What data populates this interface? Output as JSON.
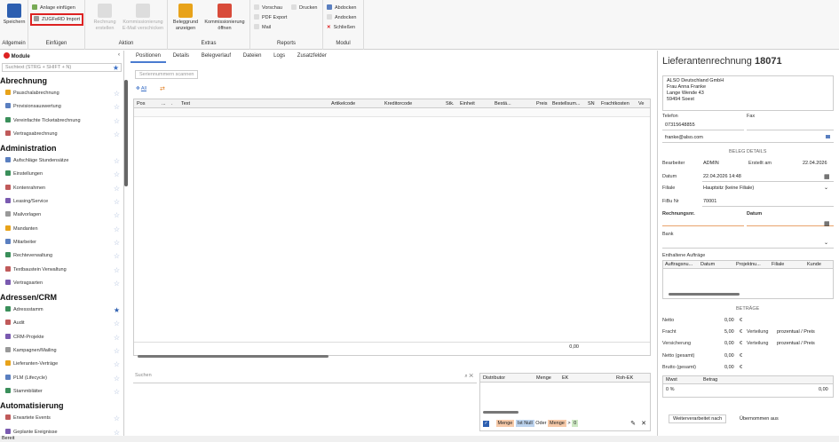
{
  "ribbon": {
    "allgemein": {
      "speichern": "Speichern",
      "label": "Allgemein"
    },
    "einfuegen": {
      "anlage": "Anlage einfügen",
      "zugferd": "ZUGFeRD Import",
      "label": "Einfügen"
    },
    "aktion": {
      "rechnung": "Rechnung erstellen",
      "kommission": "Kommissionierung E-Mail verschicken",
      "label": "Aktion"
    },
    "extras": {
      "beleggrund": "Beleggrund anzeigen",
      "kommissionierung": "Kommissionierung öffnen",
      "label": "Extras"
    },
    "reports": {
      "vorschau": "Vorschau",
      "drucken": "Drucken",
      "pdf": "PDF Export",
      "mail": "Mail",
      "label": "Reports"
    },
    "modul": {
      "abdocken": "Abdocken",
      "andocken": "Andocken",
      "schliessen": "Schließen",
      "label": "Modul"
    }
  },
  "sidebar": {
    "title": "Module",
    "collapse": "‹",
    "search_placeholder": "Suchtext (STRG + SHIFT + N)",
    "sections": [
      {
        "title": "Abrechnung",
        "items": [
          "Pauschalabrechnung",
          "Provisionsauswertung",
          "Vereinfachte Ticketabrechnung",
          "Vertragsabrechnung"
        ]
      },
      {
        "title": "Administration",
        "items": [
          "Aufschläge Stundensätze",
          "Einstellungen",
          "Kontenrahmen",
          "Leasing/Service",
          "Mailvorlagen",
          "Mandanten",
          "Mitarbeiter",
          "Rechteverwaltung",
          "Textbaustein Verwaltung",
          "Vertragsarten"
        ]
      },
      {
        "title": "Adressen/CRM",
        "items": [
          "Adressstamm",
          "Audit",
          "CRM-Projekte",
          "Kampagnen/Mailing",
          "Lieferanten-Verträge",
          "PLM (Lifecycle)",
          "Stammblätter"
        ]
      },
      {
        "title": "Automatisierung",
        "items": [
          "Erwartete Events",
          "Geplante Ereignisse"
        ]
      }
    ]
  },
  "tabs": [
    "Positionen",
    "Details",
    "Belegverlauf",
    "Dateien",
    "Logs",
    "Zusatzfelder"
  ],
  "toolbar": {
    "scan": "Seriennummern scannen",
    "all": "All"
  },
  "grid": {
    "columns": [
      "Pos",
      "...",
      ".",
      "Text",
      "Artikelcode",
      "Kreditorcode",
      "Stk.",
      "Einheit",
      "Bestä...",
      "Preis",
      "Bestellsum...",
      "SN",
      "Frachtkosten",
      "Ve"
    ],
    "total": "0,00"
  },
  "bottom": {
    "search_placeholder": "Suchen",
    "dist_cols": [
      "Distributor",
      "Menge",
      "EK",
      "Roh-EK"
    ],
    "filter": [
      "Menge",
      "Ist Null",
      "Oder",
      "Menge",
      ">",
      "0"
    ]
  },
  "right": {
    "title": "Lieferantenrechnung",
    "number": "18071",
    "address": [
      "ALSO Deutschland GmbH",
      "Frau Anna Franke",
      "Lange Wende 43",
      "59494 Soest"
    ],
    "telefon_lbl": "Telefon",
    "telefon": "07315648855",
    "fax_lbl": "Fax",
    "email": "franke@also.com",
    "details_title": "BELEG DETAILS",
    "bearbeiter_lbl": "Bearbeiter",
    "bearbeiter": "ADMIN",
    "erstellt_lbl": "Erstellt am",
    "erstellt": "22.04.2026",
    "datum_lbl": "Datum",
    "datum": "22.04.2026 14:48",
    "filiale_lbl": "Filiale",
    "filiale": "Hauptsitz (keine Filiale)",
    "fibu_lbl": "FiBu Nr",
    "fibu": "70001",
    "rechnungsnr_lbl": "Rechnungsnr.",
    "datum2_lbl": "Datum",
    "bank_lbl": "Bank",
    "auftraege_lbl": "Enthaltene Aufträge",
    "auftraege_cols": [
      "Auftragsnu...",
      "Datum",
      "Projektnu...",
      "Filiale",
      "Kunde"
    ],
    "betraege_title": "BETRÄGE",
    "netto_lbl": "Netto",
    "netto": "0,00",
    "fracht_lbl": "Fracht",
    "fracht": "5,00",
    "vers_lbl": "Versicherung",
    "vers": "0,00",
    "verteilung": "Verteilung",
    "prozentual": "prozentual / Preis",
    "netto_g_lbl": "Netto (gesamt)",
    "netto_g": "0,00",
    "brutto_lbl": "Brutto (gesamt)",
    "brutto": "0,00",
    "euro": "€",
    "mwst_cols": [
      "Mwst",
      "Betrag"
    ],
    "mwst_row": [
      "0 %",
      "0,00"
    ],
    "tabs2": [
      "Weiterverarbeitet nach",
      "Übernommen aus"
    ]
  },
  "status": "Bereit"
}
